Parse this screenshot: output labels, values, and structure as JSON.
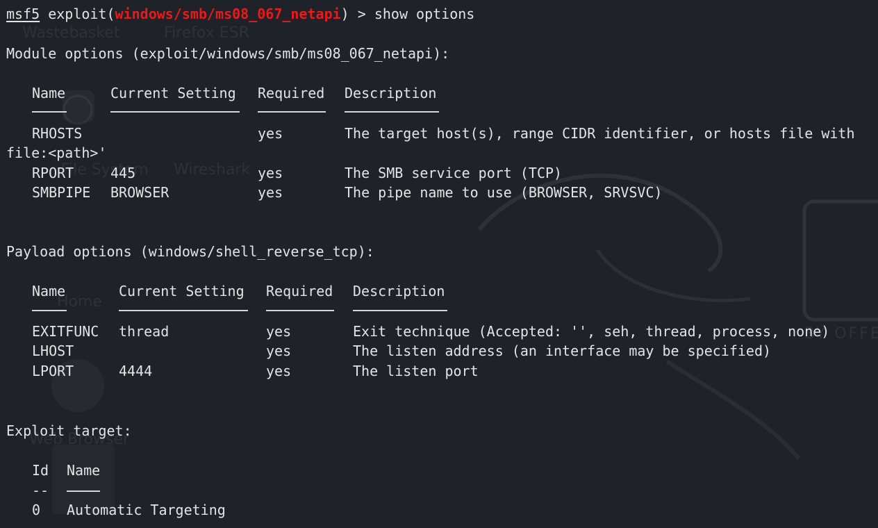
{
  "colors": {
    "background": "#1f2229",
    "text": "#e4e4e4",
    "module_highlight": "#e41c1c"
  },
  "background_desktop": {
    "shortcuts": [
      "Wastebasket",
      "Firefox ESR",
      "File System",
      "Wireshark",
      "Home",
      "Web Browser"
    ],
    "logo_text": "BY OFFE"
  },
  "prompt": {
    "msf": "msf5",
    "exploit_open": "exploit(",
    "module": "windows/smb/ms08_067_netapi",
    "exploit_close": ")",
    "arrow": ">",
    "command": "show options"
  },
  "module_options": {
    "heading": "Module options (exploit/windows/smb/ms08_067_netapi):",
    "headers": [
      "Name",
      "Current Setting",
      "Required",
      "Description"
    ],
    "rows": [
      {
        "name": "RHOSTS",
        "setting": "",
        "required": "yes",
        "description": "The target host(s), range CIDR identifier, or hosts file with",
        "wrap": "file:<path>'"
      },
      {
        "name": "RPORT",
        "setting": "445",
        "required": "yes",
        "description": "The SMB service port (TCP)"
      },
      {
        "name": "SMBPIPE",
        "setting": "BROWSER",
        "required": "yes",
        "description": "The pipe name to use (BROWSER, SRVSVC)"
      }
    ]
  },
  "payload_options": {
    "heading": "Payload options (windows/shell_reverse_tcp):",
    "headers": [
      "Name",
      "Current Setting",
      "Required",
      "Description"
    ],
    "rows": [
      {
        "name": "EXITFUNC",
        "setting": "thread",
        "required": "yes",
        "description": "Exit technique (Accepted: '', seh, thread, process, none)"
      },
      {
        "name": "LHOST",
        "setting": "",
        "required": "yes",
        "description": "The listen address (an interface may be specified)"
      },
      {
        "name": "LPORT",
        "setting": "4444",
        "required": "yes",
        "description": "The listen port"
      }
    ]
  },
  "exploit_target": {
    "heading": "Exploit target:",
    "headers": [
      "Id",
      "Name"
    ],
    "rows": [
      {
        "id": "0",
        "name": "Automatic Targeting"
      }
    ]
  }
}
